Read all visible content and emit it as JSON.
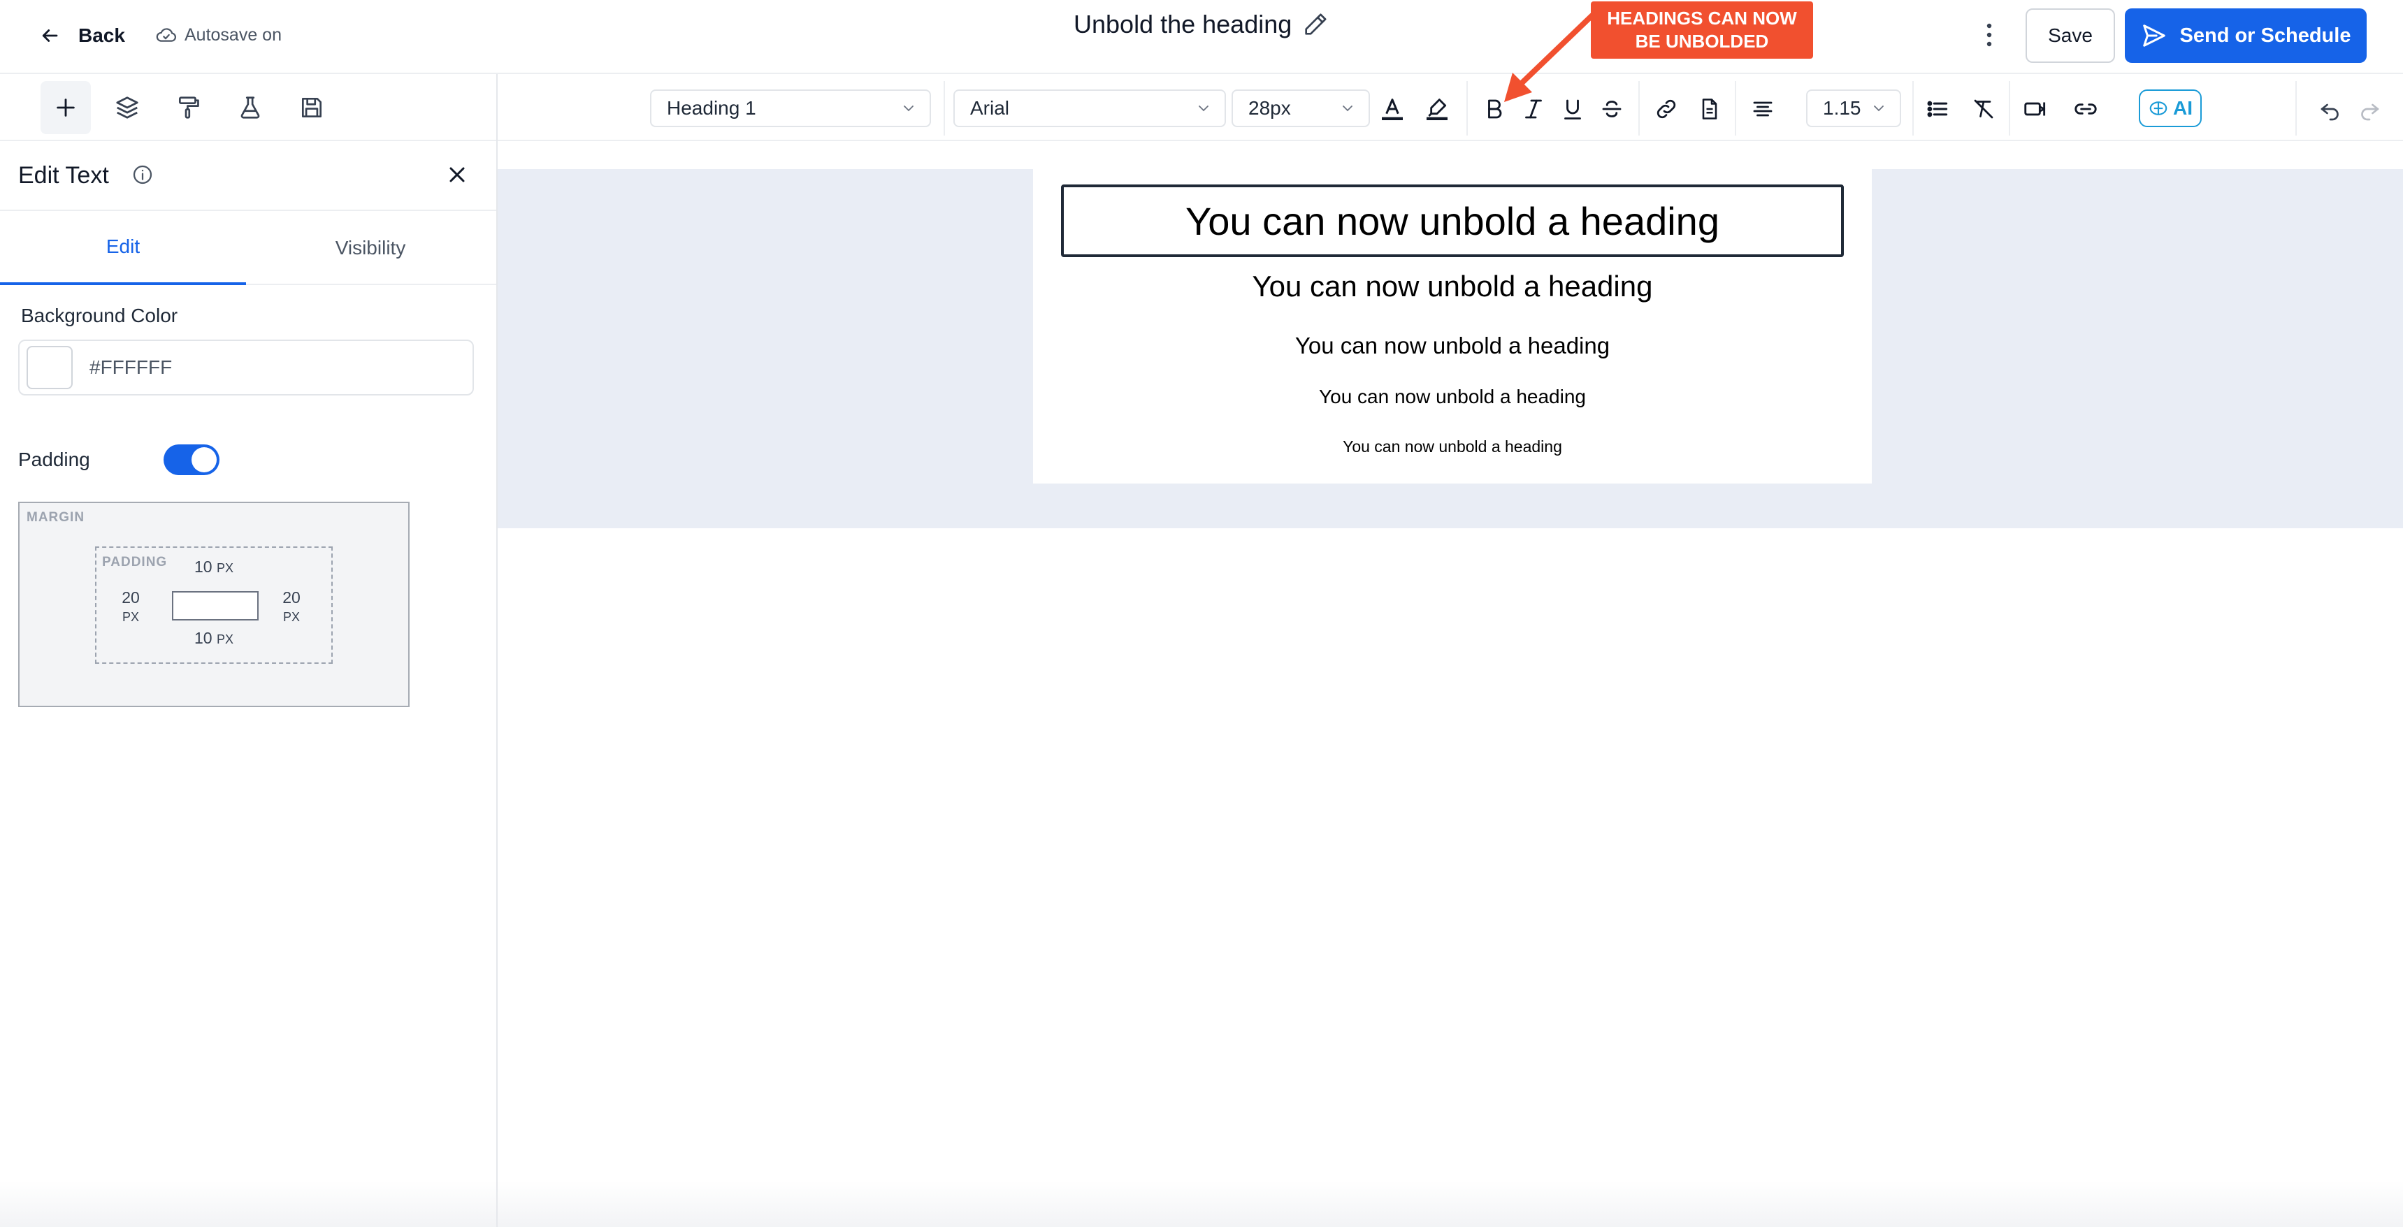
{
  "header": {
    "back_label": "Back",
    "autosave_label": "Autosave on",
    "title": "Unbold the heading",
    "callout_line1": "HEADINGS CAN NOW",
    "callout_line2": "BE UNBOLDED",
    "save_label": "Save",
    "send_label": "Send or Schedule"
  },
  "left_panel": {
    "title": "Edit Text",
    "tabs": [
      {
        "label": "Edit",
        "active": true
      },
      {
        "label": "Visibility",
        "active": false
      }
    ],
    "background_color_label": "Background Color",
    "background_color_value": "#FFFFFF",
    "padding_label": "Padding",
    "padding_enabled": true,
    "box_model": {
      "margin_label": "MARGIN",
      "padding_label": "PADDING",
      "top": "10",
      "bottom": "10",
      "left": "20",
      "right": "20",
      "unit": "PX"
    }
  },
  "toolbar": {
    "block_type": "Heading 1",
    "font_family": "Arial",
    "font_size": "28px",
    "line_height": "1.15",
    "ai_label": "AI"
  },
  "canvas": {
    "headings": [
      "You can now unbold a heading",
      "You can now unbold a heading",
      "You can now unbold a heading",
      "You can now unbold a heading",
      "You can now unbold a heading"
    ]
  },
  "colors": {
    "primary": "#1663e8",
    "callout": "#f1502f",
    "canvas_background": "#e9edf5",
    "ai_accent": "#1a9bd7"
  }
}
